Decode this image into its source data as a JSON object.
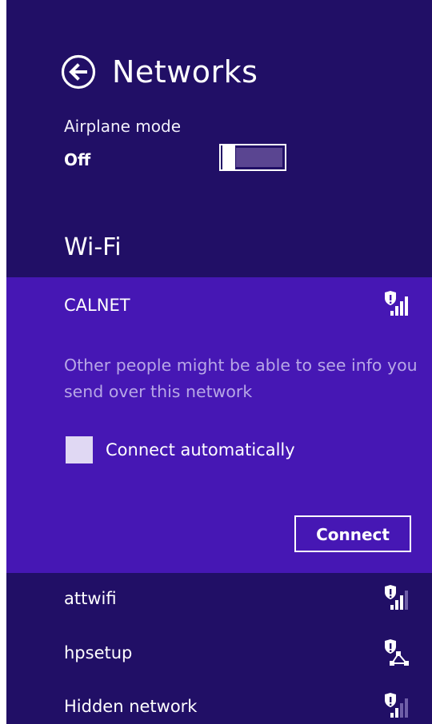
{
  "header": {
    "title": "Networks",
    "back_icon": "back-arrow-circle-icon"
  },
  "airplane_mode": {
    "label": "Airplane mode",
    "state": "Off",
    "on": false
  },
  "wifi": {
    "title": "Wi-Fi",
    "expanded_network": {
      "name": "CALNET",
      "icon": "wifi-signal-unsecured-icon",
      "warning": "Other people might be able to see info you send over this network",
      "auto_connect_label": "Connect automatically",
      "auto_connect_checked": false,
      "connect_label": "Connect"
    },
    "networks": [
      {
        "name": "attwifi",
        "icon": "wifi-signal-unsecured-icon"
      },
      {
        "name": "hpsetup",
        "icon": "adhoc-network-unsecured-icon"
      },
      {
        "name": "Hidden network",
        "icon": "wifi-signal-unsecured-icon"
      }
    ]
  },
  "colors": {
    "panel_bg": "#210f66",
    "selected_bg": "#4617b4",
    "warning_text": "#b7a7e6",
    "checkbox_fill": "#e0d8f3"
  }
}
